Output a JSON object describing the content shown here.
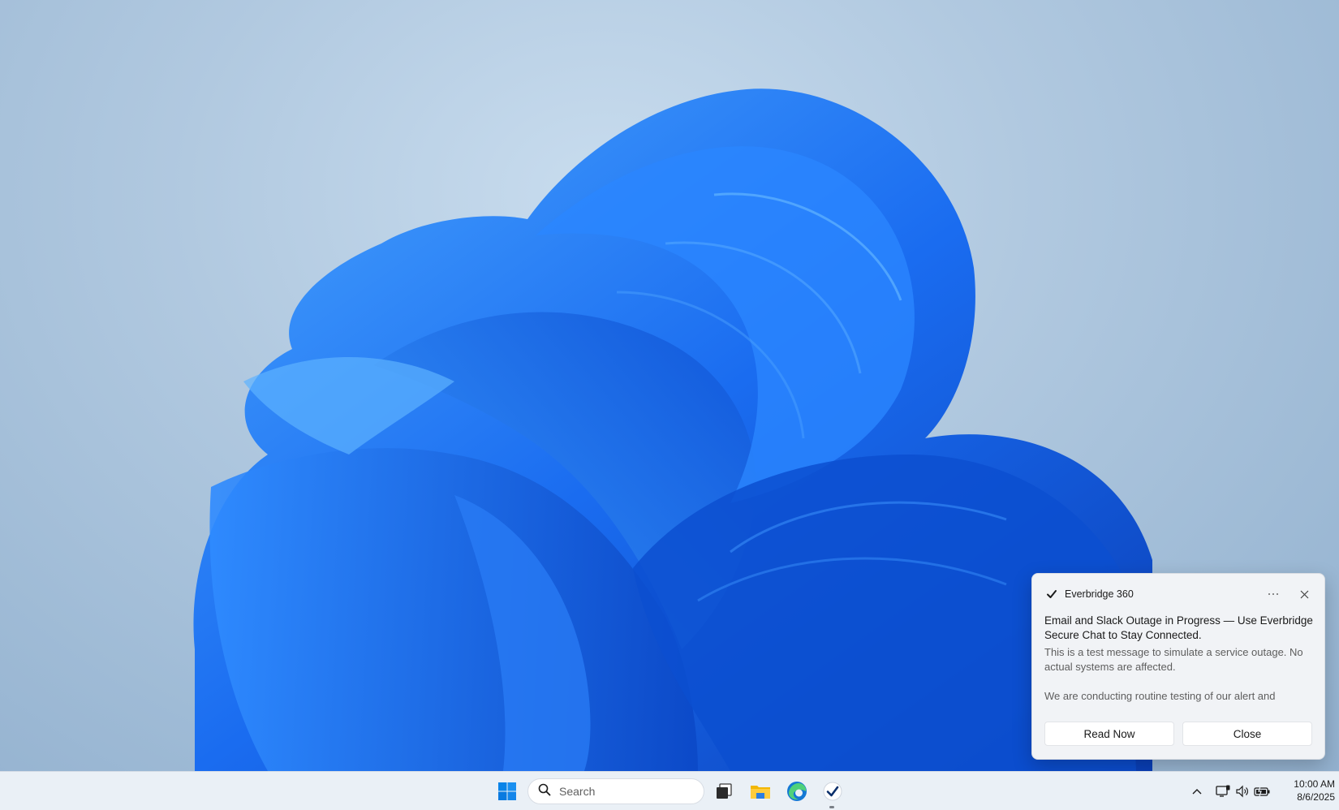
{
  "notification": {
    "app_name": "Everbridge 360",
    "more_icon": "more-options-icon",
    "close_icon": "close-icon",
    "title": "Email and Slack Outage in Progress — Use Everbridge Secure Chat to Stay Connected.",
    "body_line1": "This is a test message to simulate a service outage. No actual systems are affected.",
    "body_line2": "We are conducting routine testing of our alert and",
    "buttons": {
      "read_now": "Read Now",
      "close": "Close"
    }
  },
  "taskbar": {
    "search_placeholder": "Search",
    "icons": [
      "windows-start-icon",
      "search-icon",
      "task-view-icon",
      "file-explorer-icon",
      "edge-browser-icon",
      "everbridge-icon"
    ],
    "tray": [
      "chevron-up-icon",
      "network-icon",
      "volume-icon",
      "battery-icon"
    ],
    "clock": {
      "time": "10:00 AM",
      "date": "8/6/2025"
    }
  },
  "colors": {
    "accent": "#0078d4",
    "wallpaper_blue": "#1a6ef0"
  }
}
